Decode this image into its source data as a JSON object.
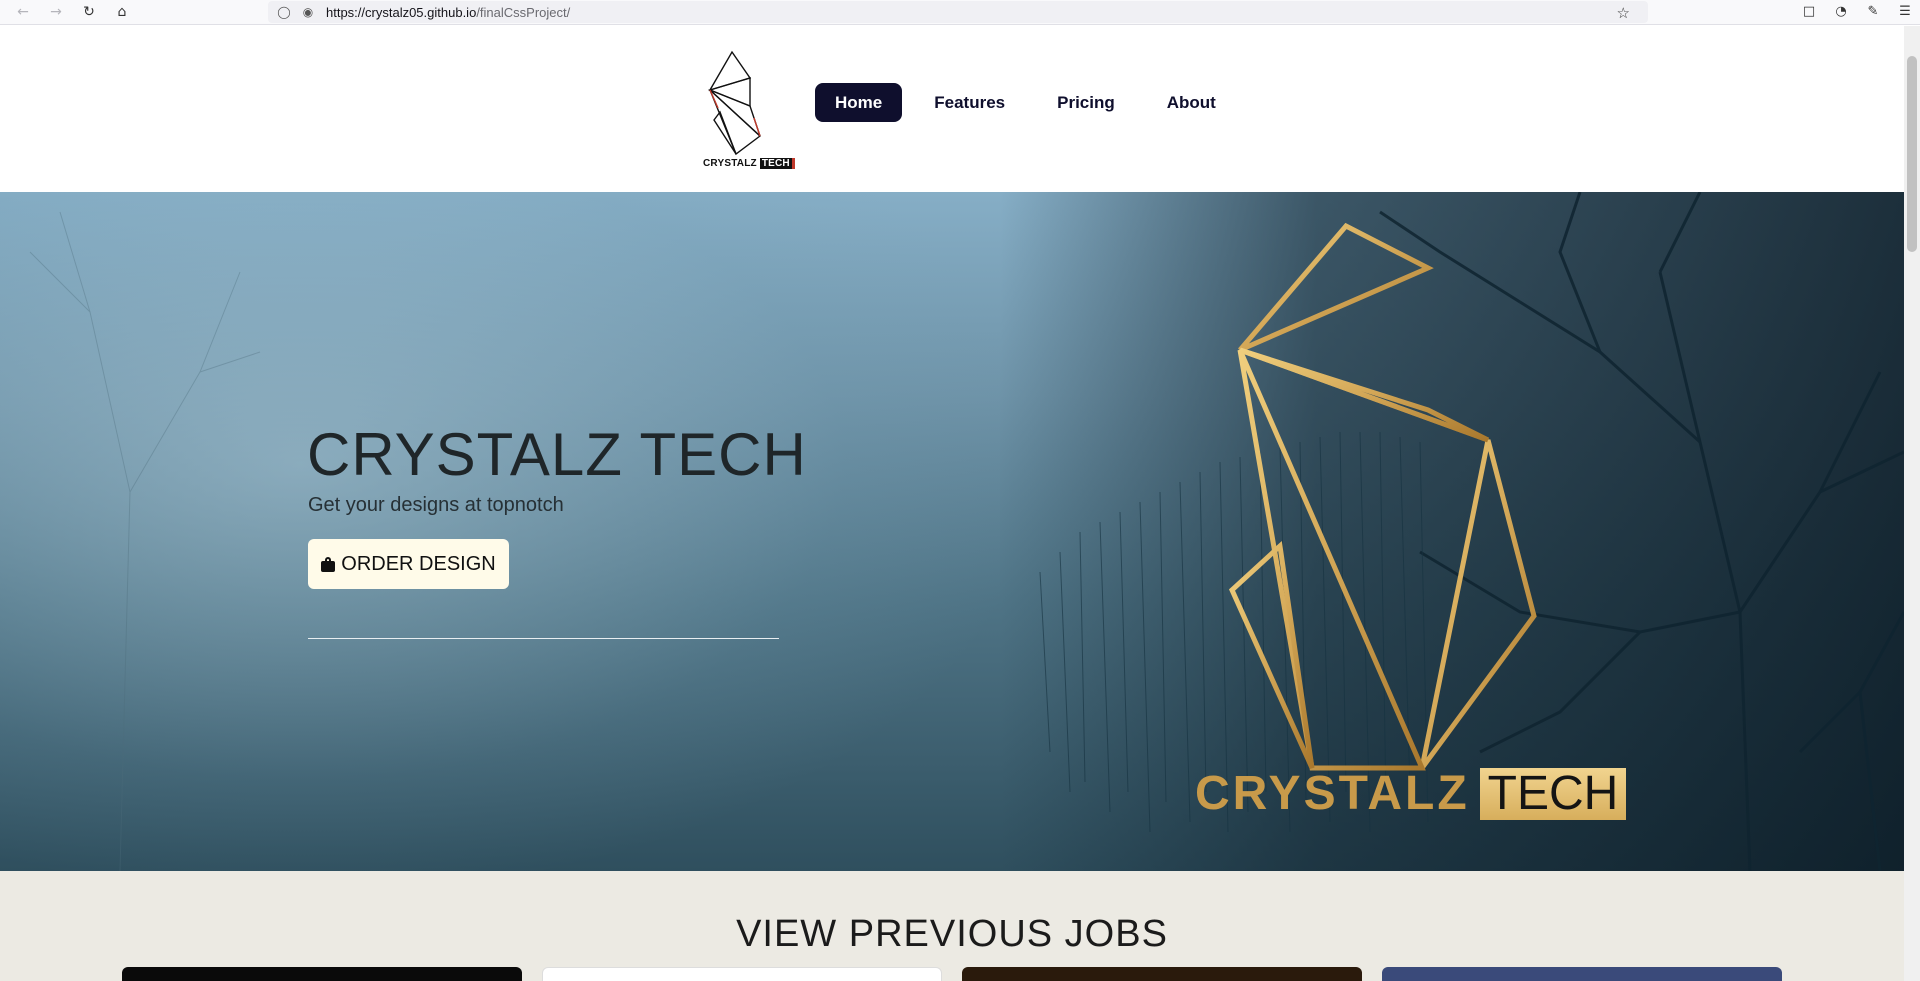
{
  "browser": {
    "url_host": "https://crystalz05.github.io",
    "url_path": "/finalCssProject/"
  },
  "header": {
    "logo_word1": "CRYSTALZ",
    "logo_word2": "TECH",
    "nav": [
      {
        "label": "Home",
        "active": true
      },
      {
        "label": "Features",
        "active": false
      },
      {
        "label": "Pricing",
        "active": false
      },
      {
        "label": "About",
        "active": false
      }
    ]
  },
  "hero": {
    "title": "CRYSTALZ TECH",
    "subtitle": "Get your designs at topnotch",
    "cta_label": "ORDER DESIGN",
    "brand_word1": "CRYSTALZ",
    "brand_word2": "TECH"
  },
  "jobs": {
    "title": "VIEW PREVIOUS JOBS",
    "cards": [
      {
        "color": "#0a0a0a"
      },
      {
        "color": "#ffffff"
      },
      {
        "color": "#2a1a0c"
      },
      {
        "color": "#3a4a7a"
      }
    ]
  },
  "colors": {
    "nav_active_bg": "#0f0f2d",
    "gold": "#c89a4a",
    "cta_bg": "#fffbe9"
  }
}
